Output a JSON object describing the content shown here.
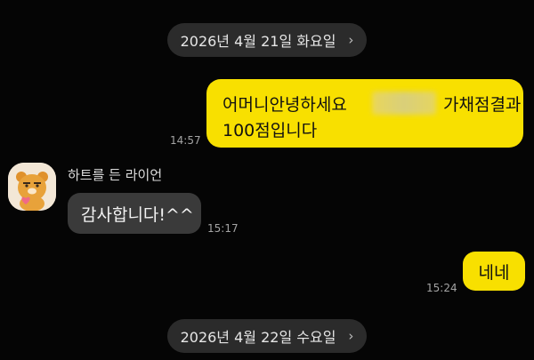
{
  "dates": [
    {
      "label": "2026년 4월 21일 화요일",
      "chevron": "›"
    },
    {
      "label": "2026년 4월 22일 수요일",
      "chevron": "›"
    }
  ],
  "messages": [
    {
      "side": "right",
      "line1": "어머니안녕하세요",
      "line1_end": "가채점결과",
      "line2": "100점입니다",
      "time": "14:57"
    },
    {
      "side": "left",
      "sender": "하트를 든 라이언",
      "text": "감사합니다!^^",
      "time": "15:17"
    },
    {
      "side": "right",
      "text": "네네",
      "time": "15:24"
    }
  ],
  "colors": {
    "background": "#050505",
    "my_bubble": "#f8e000",
    "their_bubble": "#3a3a3a",
    "date_pill": "#2b2b2b"
  },
  "icons": {
    "avatar": "ryan-heart-avatar",
    "date_chevron": "chevron-right-icon"
  }
}
